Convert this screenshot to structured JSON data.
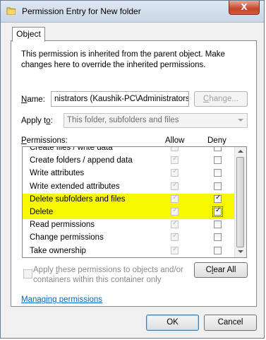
{
  "window": {
    "title": "Permission Entry for New folder",
    "close_label": "X"
  },
  "tabs": [
    {
      "label": "Object"
    }
  ],
  "info_text": "This permission is inherited from the parent object. Make changes here to override the inherited permissions.",
  "name_field": {
    "label_underlined": "N",
    "label_rest": "ame:",
    "value": "nistrators (Kaushik-PC\\Administrators)",
    "change_button_underlined": "C",
    "change_button_rest": "hange..."
  },
  "apply_to": {
    "label_prefix": "Apply t",
    "label_underlined": "o",
    "label_suffix": ":",
    "value": "This folder, subfolders and files"
  },
  "permissions": {
    "label_underlined": "P",
    "label_rest": "ermissions:",
    "allow_header": "Allow",
    "deny_header": "Deny",
    "rows": [
      {
        "name": "Create files / write data",
        "allow": true,
        "deny": false,
        "highlight": false
      },
      {
        "name": "Create folders / append data",
        "allow": true,
        "deny": false,
        "highlight": false
      },
      {
        "name": "Write attributes",
        "allow": true,
        "deny": false,
        "highlight": false
      },
      {
        "name": "Write extended attributes",
        "allow": true,
        "deny": false,
        "highlight": false
      },
      {
        "name": "Delete subfolders and files",
        "allow": true,
        "deny": true,
        "highlight": true
      },
      {
        "name": "Delete",
        "allow": true,
        "deny": true,
        "highlight": true
      },
      {
        "name": "Read permissions",
        "allow": true,
        "deny": false,
        "highlight": false
      },
      {
        "name": "Change permissions",
        "allow": true,
        "deny": false,
        "highlight": false
      },
      {
        "name": "Take ownership",
        "allow": true,
        "deny": false,
        "highlight": false
      }
    ]
  },
  "apply_inherit": {
    "prefix": "Apply ",
    "underlined": "t",
    "rest": "hese permissions to objects and/or containers within this container only",
    "checked": false
  },
  "clear_all": {
    "prefix": "C",
    "underlined": "l",
    "rest": "ear All"
  },
  "managing_link": "Managing permissions",
  "footer": {
    "ok_label": "OK",
    "cancel_label": "Cancel"
  },
  "colors": {
    "highlight": "#f8f800",
    "link": "#0066cc",
    "titlebar": "#c9d6e6"
  }
}
